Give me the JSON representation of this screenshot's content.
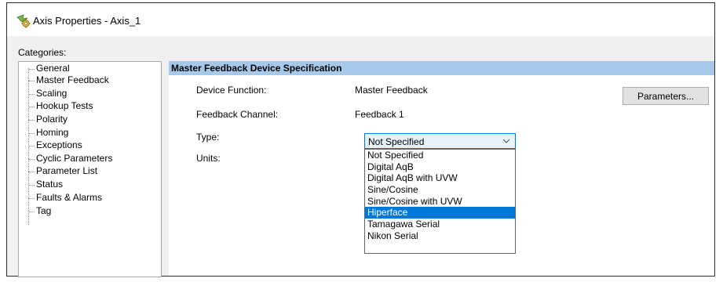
{
  "window": {
    "title": "Axis Properties - Axis_1"
  },
  "categories": {
    "label": "Categories:",
    "items": [
      {
        "label": "General"
      },
      {
        "label": "Master Feedback"
      },
      {
        "label": "Scaling"
      },
      {
        "label": "Hookup Tests"
      },
      {
        "label": "Polarity"
      },
      {
        "label": "Homing"
      },
      {
        "label": "Exceptions"
      },
      {
        "label": "Cyclic Parameters"
      },
      {
        "label": "Parameter List"
      },
      {
        "label": "Status"
      },
      {
        "label": "Faults & Alarms"
      },
      {
        "label": "Tag"
      }
    ]
  },
  "section": {
    "title": "Master Feedback Device Specification"
  },
  "fields": {
    "device_function": {
      "label": "Device Function:",
      "value": "Master Feedback"
    },
    "feedback_channel": {
      "label": "Feedback Channel:",
      "value": "Feedback 1"
    },
    "type": {
      "label": "Type:",
      "value": "Not Specified"
    },
    "units": {
      "label": "Units:"
    }
  },
  "buttons": {
    "parameters": "Parameters..."
  },
  "type_dropdown": {
    "highlighted": "Hiperface",
    "options": [
      {
        "label": "Not Specified"
      },
      {
        "label": "Digital AqB"
      },
      {
        "label": "Digital AqB with UVW"
      },
      {
        "label": "Sine/Cosine"
      },
      {
        "label": "Sine/Cosine with UVW"
      },
      {
        "label": "Hiperface"
      },
      {
        "label": "Tamagawa Serial"
      },
      {
        "label": "Nikon Serial"
      }
    ]
  },
  "colors": {
    "section_header_bg": "#a6c8ea",
    "select_focus_border": "#0078d7",
    "highlight_bg": "#0078d7",
    "highlight_text": "#ffffff"
  },
  "icons": {
    "title": "axis-properties-icon",
    "dropdown": "chevron-down-icon"
  }
}
